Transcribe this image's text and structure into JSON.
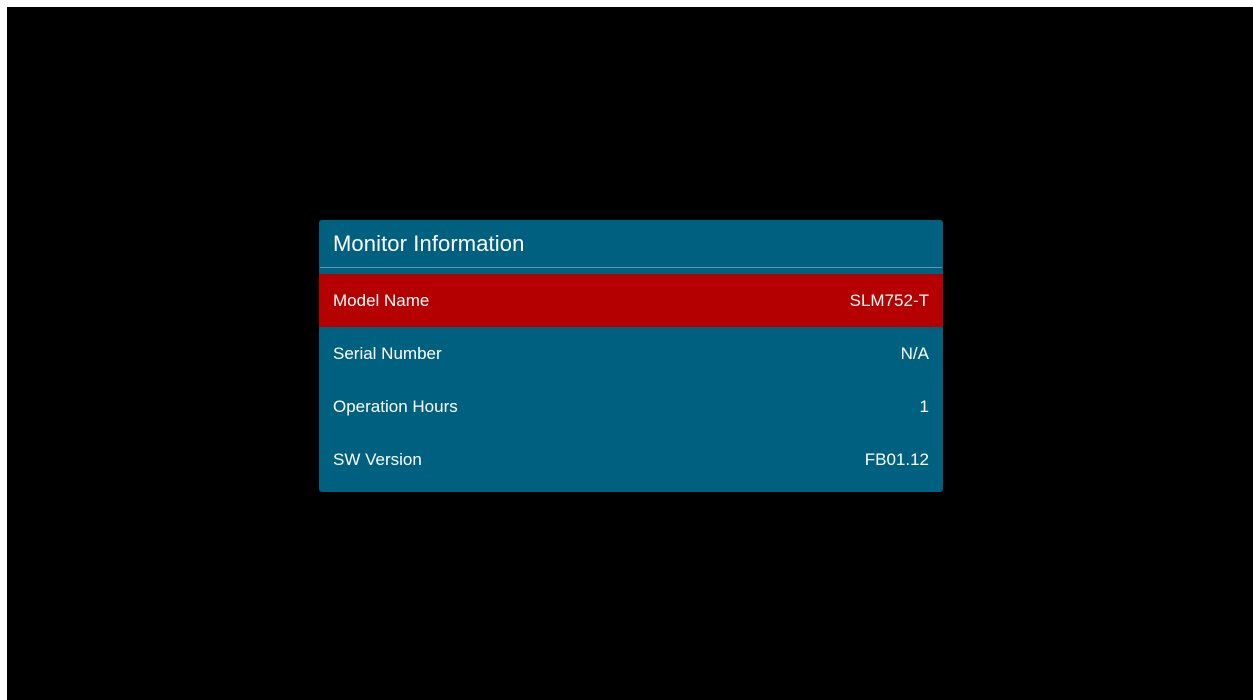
{
  "panel": {
    "title": "Monitor Information",
    "colors": {
      "panel_background": "#00607f",
      "selected_row": "#b50000",
      "screen_background": "#000000"
    },
    "rows": [
      {
        "label": "Model Name",
        "value": "SLM752-T",
        "selected": true
      },
      {
        "label": "Serial Number",
        "value": "N/A",
        "selected": false
      },
      {
        "label": "Operation Hours",
        "value": "1",
        "selected": false
      },
      {
        "label": "SW Version",
        "value": "FB01.12",
        "selected": false
      }
    ]
  }
}
